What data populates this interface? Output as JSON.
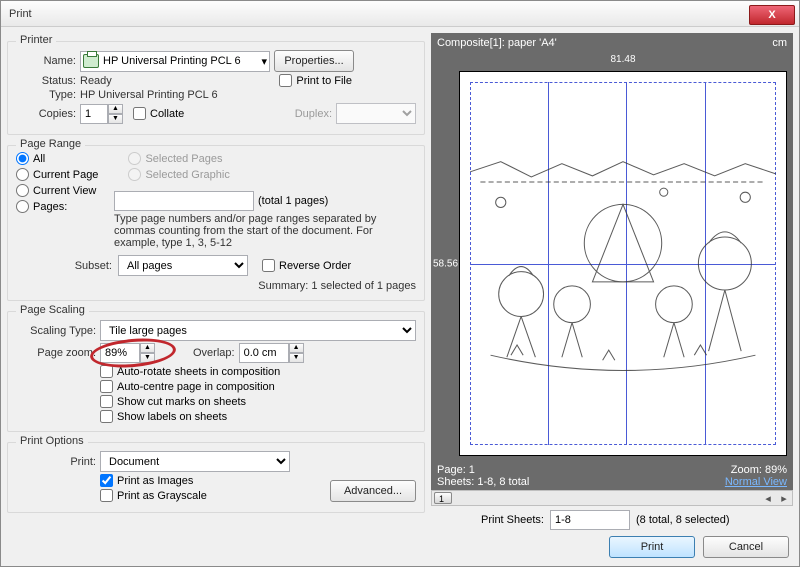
{
  "window": {
    "title": "Print",
    "close_x": "X"
  },
  "printer": {
    "legend": "Printer",
    "name_label": "Name:",
    "name_value": "HP Universal Printing PCL 6",
    "properties_btn": "Properties...",
    "status_label": "Status:",
    "status_value": "Ready",
    "type_label": "Type:",
    "type_value": "HP Universal Printing PCL 6",
    "copies_label": "Copies:",
    "copies_value": "1",
    "collate_label": "Collate",
    "print_to_file_label": "Print to File",
    "duplex_label": "Duplex:",
    "duplex_value": ""
  },
  "page_range": {
    "legend": "Page Range",
    "all": "All",
    "current_page": "Current Page",
    "current_view": "Current View",
    "pages": "Pages:",
    "selected_pages": "Selected Pages",
    "selected_graphic": "Selected Graphic",
    "total_pages": "(total 1 pages)",
    "hint": "Type page numbers and/or page ranges separated by commas counting from the start of the document. For example, type 1, 3, 5-12",
    "subset_label": "Subset:",
    "subset_value": "All pages",
    "reverse_order": "Reverse Order",
    "summary": "Summary: 1 selected of 1 pages"
  },
  "scaling": {
    "legend": "Page Scaling",
    "type_label": "Scaling Type:",
    "type_value": "Tile large pages",
    "zoom_label": "Page zoom:",
    "zoom_value": "89%",
    "overlap_label": "Overlap:",
    "overlap_value": "0.0 cm",
    "auto_rotate": "Auto-rotate sheets in composition",
    "auto_centre": "Auto-centre page in composition",
    "cut_marks": "Show cut marks on sheets",
    "labels": "Show labels on sheets"
  },
  "options": {
    "legend": "Print Options",
    "print_label": "Print:",
    "print_value": "Document",
    "as_images": "Print as Images",
    "as_grayscale": "Print as Grayscale",
    "advanced_btn": "Advanced..."
  },
  "preview": {
    "header_title": "Composite[1]: paper 'A4'",
    "unit": "cm",
    "ruler_top": "81.48",
    "ruler_left": "58.56",
    "page_label": "Page: 1",
    "zoom_label": "Zoom: 89%",
    "sheets_label": "Sheets: 1-8, 8 total",
    "normal_view": "Normal View",
    "scroll_pos": "1",
    "print_sheets_label": "Print Sheets:",
    "print_sheets_value": "1-8",
    "print_sheets_info": "(8 total, 8 selected)"
  },
  "buttons": {
    "print": "Print",
    "cancel": "Cancel"
  }
}
